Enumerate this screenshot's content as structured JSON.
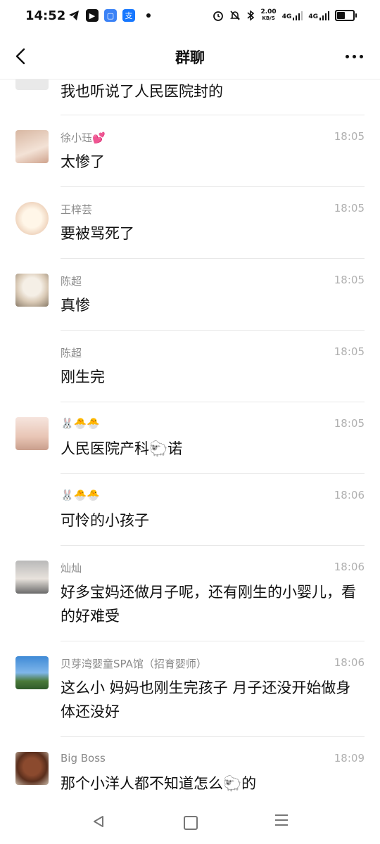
{
  "status_bar": {
    "time": "14:52",
    "net_speed_value": "2.00",
    "net_speed_unit": "KB/S",
    "net1": "4G",
    "net2": "4G",
    "battery_fraction": 0.45
  },
  "header": {
    "title": "群聊"
  },
  "messages": [
    {
      "name": "",
      "time": "",
      "text": "我也听说了人民医院封的"
    },
    {
      "name": "徐小珏💕",
      "time": "18:05",
      "text": "太惨了"
    },
    {
      "name": "王梓芸",
      "time": "18:05",
      "text": "要被骂死了"
    },
    {
      "name": "陈超",
      "time": "18:05",
      "text": "真惨"
    },
    {
      "name": "陈超",
      "time": "18:05",
      "text": "刚生完"
    },
    {
      "name": "🐰🐣🐣",
      "time": "18:05",
      "text": "人民医院产科🐑诺"
    },
    {
      "name": "🐰🐣🐣",
      "time": "18:06",
      "text": "可怜的小孩子"
    },
    {
      "name": "灿灿",
      "time": "18:06",
      "text": "好多宝妈还做月子呢，还有刚生的小婴儿，看的好难受"
    },
    {
      "name": "贝芽湾婴童SPA馆（招育婴师）",
      "time": "18:06",
      "text": "这么小 妈妈也刚生完孩子 月子还没开始做身体还没好"
    },
    {
      "name": "Big Boss",
      "time": "18:09",
      "text": "那个小洋人都不知道怎么🐑的"
    }
  ]
}
